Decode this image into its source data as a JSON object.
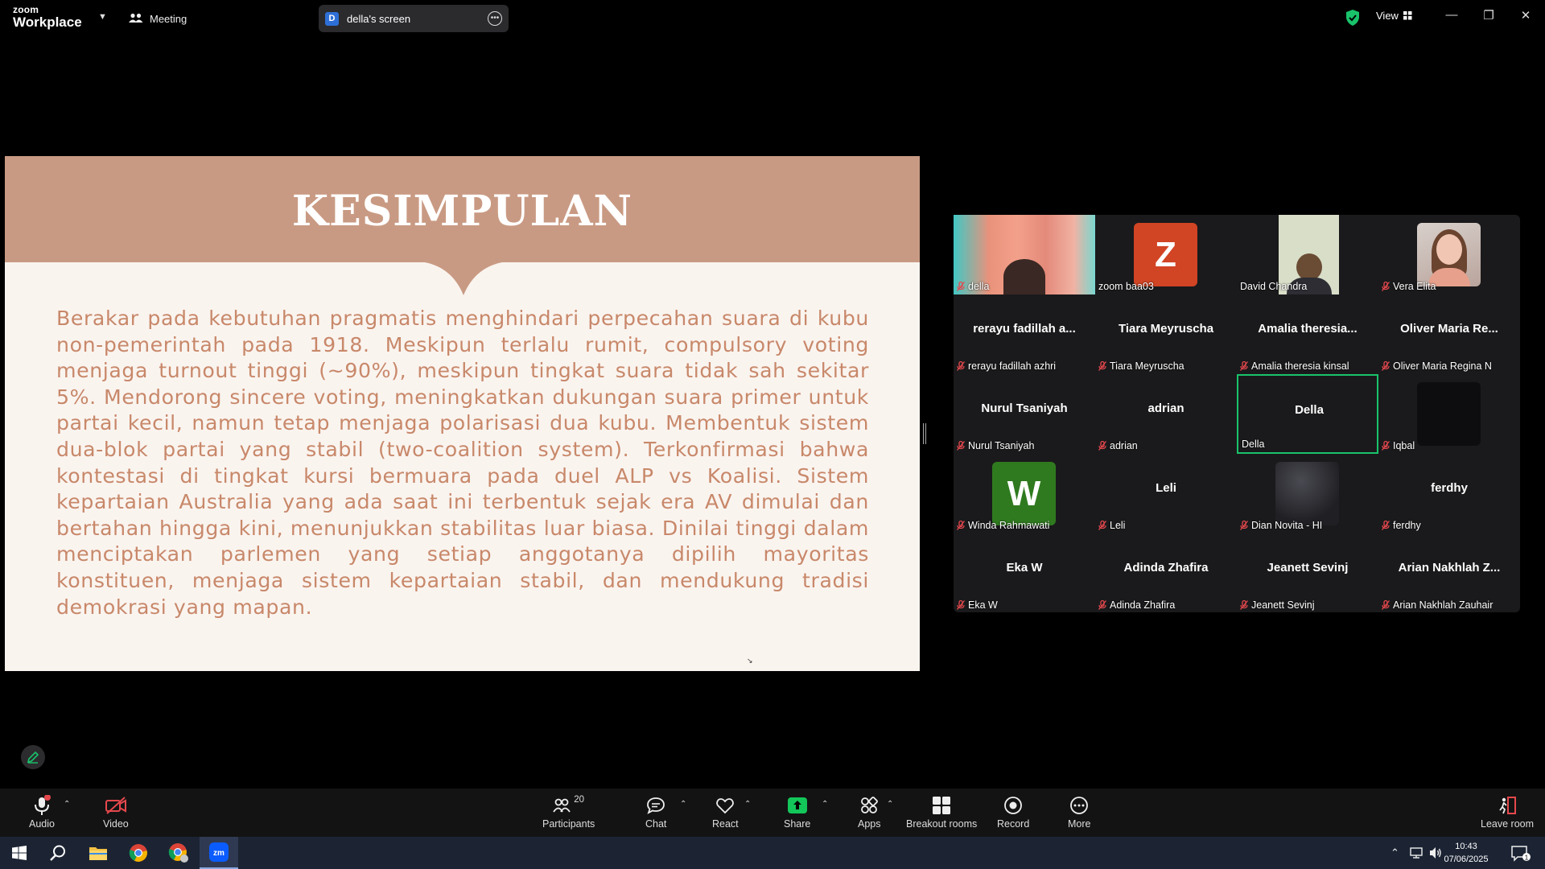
{
  "app": {
    "brand_top": "zoom",
    "brand_bottom": "Workplace",
    "meeting_label": "Meeting",
    "screen_tab_initial": "D",
    "screen_tab_label": "della's screen",
    "view_label": "View"
  },
  "slide": {
    "title": "KESIMPULAN",
    "body": "Berakar pada kebutuhan pragmatis menghindari perpecahan suara di kubu non-pemerintah pada 1918. Meskipun terlalu  rumit, compulsory voting menjaga turnout tinggi (~90%), meskipun tingkat suara tidak sah sekitar 5%. Mendorong sincere voting, meningkatkan dukungan suara primer untuk partai kecil, namun tetap menjaga polarisasi dua kubu. Membentuk sistem dua-blok partai yang stabil (two-coalition system). Terkonfirmasi bahwa kontestasi di tingkat kursi bermuara pada duel ALP vs Koalisi. Sistem kepartaian Australia yang ada saat ini terbentuk sejak era AV dimulai dan bertahan hingga kini, menunjukkan stabilitas luar biasa. Dinilai tinggi dalam menciptakan parlemen yang setiap anggotanya dipilih mayoritas konstituen, menjaga sistem kepartaian stabil, dan mendukung tradisi demokrasi yang mapan.",
    "header_color": "#c99a83",
    "body_color": "#c8886a",
    "background": "#faf4ef"
  },
  "participants": [
    {
      "label": "della",
      "name": "",
      "kind": "video-della",
      "muted": true
    },
    {
      "label": "zoom baa03",
      "name": "",
      "kind": "avatar-z",
      "avatar": "Z",
      "muted": false
    },
    {
      "label": "David Chandra",
      "name": "",
      "kind": "video-david",
      "muted": false
    },
    {
      "label": "Vera Elita",
      "name": "",
      "kind": "photo-vera",
      "muted": true
    },
    {
      "label": "rerayu fadillah azhri",
      "name": "rerayu fadillah a...",
      "kind": "name",
      "muted": true
    },
    {
      "label": "Tiara Meyruscha",
      "name": "Tiara Meyruscha",
      "kind": "name",
      "muted": true
    },
    {
      "label": "Amalia theresia kinsal",
      "name": "Amalia theresia...",
      "kind": "name",
      "muted": true
    },
    {
      "label": "Oliver Maria Regina N",
      "name": "Oliver Maria Re...",
      "kind": "name",
      "muted": true
    },
    {
      "label": "Nurul Tsaniyah",
      "name": "Nurul Tsaniyah",
      "kind": "name",
      "muted": true
    },
    {
      "label": "adrian",
      "name": "adrian",
      "kind": "name",
      "muted": true
    },
    {
      "label": "Della",
      "name": "Della",
      "kind": "name",
      "muted": false,
      "active": true
    },
    {
      "label": "Iqbal",
      "name": "",
      "kind": "black-box",
      "muted": true
    },
    {
      "label": "Winda Rahmawati",
      "name": "",
      "kind": "avatar-w",
      "avatar": "W",
      "muted": true
    },
    {
      "label": "Leli",
      "name": "Leli",
      "kind": "name",
      "muted": true
    },
    {
      "label": "Dian Novita - HI",
      "name": "",
      "kind": "photo-dian",
      "muted": true
    },
    {
      "label": "ferdhy",
      "name": "ferdhy",
      "kind": "name",
      "muted": true
    },
    {
      "label": "Eka W",
      "name": "Eka W",
      "kind": "name",
      "muted": true
    },
    {
      "label": "Adinda Zhafira",
      "name": "Adinda Zhafira",
      "kind": "name",
      "muted": true
    },
    {
      "label": "Jeanett Sevinj",
      "name": "Jeanett Sevinj",
      "kind": "name",
      "muted": true
    },
    {
      "label": "Arian Nakhlah Zauhair",
      "name": "Arian Nakhlah Z...",
      "kind": "name",
      "muted": true
    }
  ],
  "toolbar": {
    "audio": "Audio",
    "video": "Video",
    "participants": "Participants",
    "participants_count": "20",
    "chat": "Chat",
    "react": "React",
    "share": "Share",
    "apps": "Apps",
    "breakout": "Breakout rooms",
    "record": "Record",
    "more": "More",
    "leave": "Leave room"
  },
  "taskbar": {
    "zoom_label": "zm",
    "time": "10:43",
    "date": "07/06/2025",
    "notif_count": "1"
  },
  "colors": {
    "accent_green": "#19c36b",
    "share_green": "#13c65a",
    "mute_red": "#e5484d"
  }
}
